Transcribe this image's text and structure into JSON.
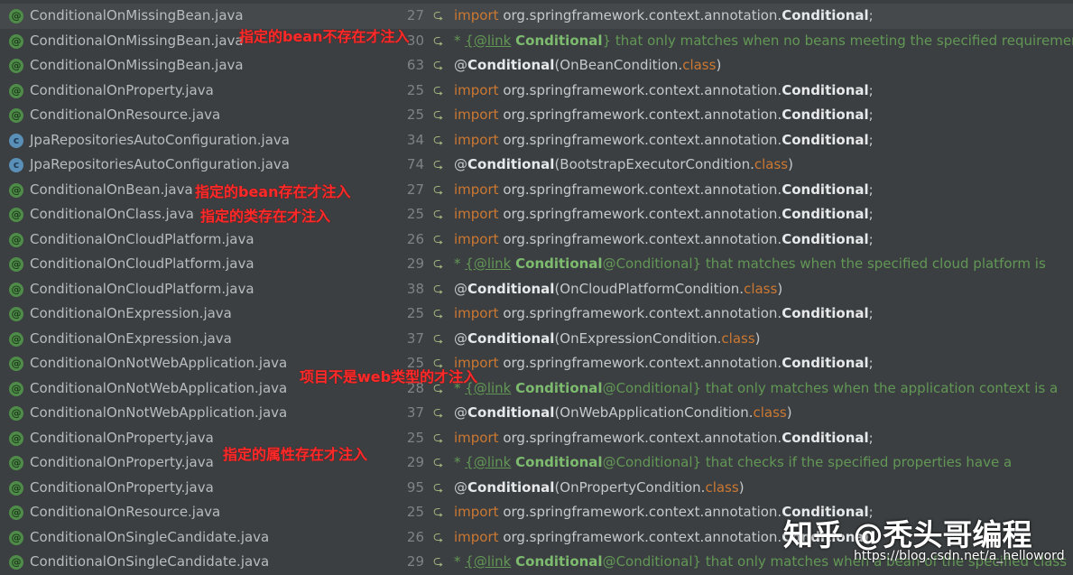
{
  "results": [
    {
      "file": "ConditionalOnMissingBean.java",
      "icon": "anno",
      "line": "27",
      "type": "import",
      "pre": "org.springframework.context.annotation.",
      "sym": "Conditional",
      "post": ";"
    },
    {
      "file": "ConditionalOnMissingBean.java",
      "icon": "anno",
      "line": "30",
      "type": "comment",
      "tag": "{@link",
      "sym": "Conditional",
      "post": "} that only matches when no beans meeting the specified requirements"
    },
    {
      "file": "ConditionalOnMissingBean.java",
      "icon": "anno",
      "line": "63",
      "type": "annot",
      "sym": "Conditional",
      "args": "OnBeanCondition",
      "kwcls": "class"
    },
    {
      "file": "ConditionalOnProperty.java",
      "icon": "anno",
      "line": "25",
      "type": "import",
      "pre": "org.springframework.context.annotation.",
      "sym": "Conditional",
      "post": ";"
    },
    {
      "file": "ConditionalOnResource.java",
      "icon": "anno",
      "line": "25",
      "type": "import",
      "pre": "org.springframework.context.annotation.",
      "sym": "Conditional",
      "post": ";"
    },
    {
      "file": "JpaRepositoriesAutoConfiguration.java",
      "icon": "cls",
      "line": "34",
      "type": "import",
      "pre": "org.springframework.context.annotation.",
      "sym": "Conditional",
      "post": ";"
    },
    {
      "file": "JpaRepositoriesAutoConfiguration.java",
      "icon": "cls",
      "line": "74",
      "type": "annot",
      "sym": "Conditional",
      "args": "BootstrapExecutorCondition",
      "kwcls": "class"
    },
    {
      "file": "ConditionalOnBean.java",
      "icon": "anno",
      "line": "27",
      "type": "import",
      "pre": "org.springframework.context.annotation.",
      "sym": "Conditional",
      "post": ";"
    },
    {
      "file": "ConditionalOnClass.java",
      "icon": "anno",
      "line": "25",
      "type": "import",
      "pre": "org.springframework.context.annotation.",
      "sym": "Conditional",
      "post": ";"
    },
    {
      "file": "ConditionalOnCloudPlatform.java",
      "icon": "anno",
      "line": "26",
      "type": "import",
      "pre": "org.springframework.context.annotation.",
      "sym": "Conditional",
      "post": ";"
    },
    {
      "file": "ConditionalOnCloudPlatform.java",
      "icon": "anno",
      "line": "29",
      "type": "comment",
      "tag": "{@link",
      "sym": "Conditional",
      "post": "@Conditional} that matches when the specified cloud platform is"
    },
    {
      "file": "ConditionalOnCloudPlatform.java",
      "icon": "anno",
      "line": "38",
      "type": "annot",
      "sym": "Conditional",
      "args": "OnCloudPlatformCondition",
      "kwcls": "class"
    },
    {
      "file": "ConditionalOnExpression.java",
      "icon": "anno",
      "line": "25",
      "type": "import",
      "pre": "org.springframework.context.annotation.",
      "sym": "Conditional",
      "post": ";"
    },
    {
      "file": "ConditionalOnExpression.java",
      "icon": "anno",
      "line": "37",
      "type": "annot",
      "sym": "Conditional",
      "args": "OnExpressionCondition",
      "kwcls": "class"
    },
    {
      "file": "ConditionalOnNotWebApplication.java",
      "icon": "anno",
      "line": "25",
      "type": "import",
      "pre": "org.springframework.context.annotation.",
      "sym": "Conditional",
      "post": ";"
    },
    {
      "file": "ConditionalOnNotWebApplication.java",
      "icon": "anno",
      "line": "28",
      "type": "comment",
      "tag": "{@link",
      "sym": "Conditional",
      "post": "@Conditional} that only matches when the application context is a"
    },
    {
      "file": "ConditionalOnNotWebApplication.java",
      "icon": "anno",
      "line": "37",
      "type": "annot",
      "sym": "Conditional",
      "args": "OnWebApplicationCondition",
      "kwcls": "class"
    },
    {
      "file": "ConditionalOnProperty.java",
      "icon": "anno",
      "line": "25",
      "type": "import",
      "pre": "org.springframework.context.annotation.",
      "sym": "Conditional",
      "post": ";"
    },
    {
      "file": "ConditionalOnProperty.java",
      "icon": "anno",
      "line": "29",
      "type": "comment",
      "tag": "{@link",
      "sym": "Conditional",
      "post": "@Conditional} that checks if the specified properties have a"
    },
    {
      "file": "ConditionalOnProperty.java",
      "icon": "anno",
      "line": "95",
      "type": "annot",
      "sym": "Conditional",
      "args": "OnPropertyCondition",
      "kwcls": "class"
    },
    {
      "file": "ConditionalOnResource.java",
      "icon": "anno",
      "line": "25",
      "type": "import",
      "pre": "org.springframework.context.annotation.",
      "sym": "Conditional",
      "post": ";"
    },
    {
      "file": "ConditionalOnSingleCandidate.java",
      "icon": "anno",
      "line": "26",
      "type": "import",
      "pre": "org.springframework.context.annotation.",
      "sym": "Conditional",
      "post": ";"
    },
    {
      "file": "ConditionalOnSingleCandidate.java",
      "icon": "anno",
      "line": "29",
      "type": "comment",
      "tag": "{@link",
      "sym": "Conditional",
      "post": "@Conditional} that only matches when a bean of the specified class"
    }
  ],
  "keywords": {
    "import": "import",
    "at": "@",
    "comment_star": "*"
  },
  "icons": {
    "anno": "annotation-file-icon",
    "cls": "class-file-icon",
    "gutter": "implementation-gutter-icon"
  },
  "colors": {
    "background": "#3b3f41",
    "keyword": "#cc7832",
    "comment": "#629755",
    "annotation_red": "#ff2a2a"
  },
  "notes": {
    "missing_bean": "指定的bean不存在才注入",
    "on_bean": "指定的bean存在才注入",
    "on_class": "指定的类存在才注入",
    "not_web": "项目不是web类型的才注入",
    "on_property": "指定的属性存在才注入"
  },
  "watermark": {
    "brand": "知乎 @秃头哥编程",
    "url": "https://blog.csdn.net/a_helloword"
  }
}
